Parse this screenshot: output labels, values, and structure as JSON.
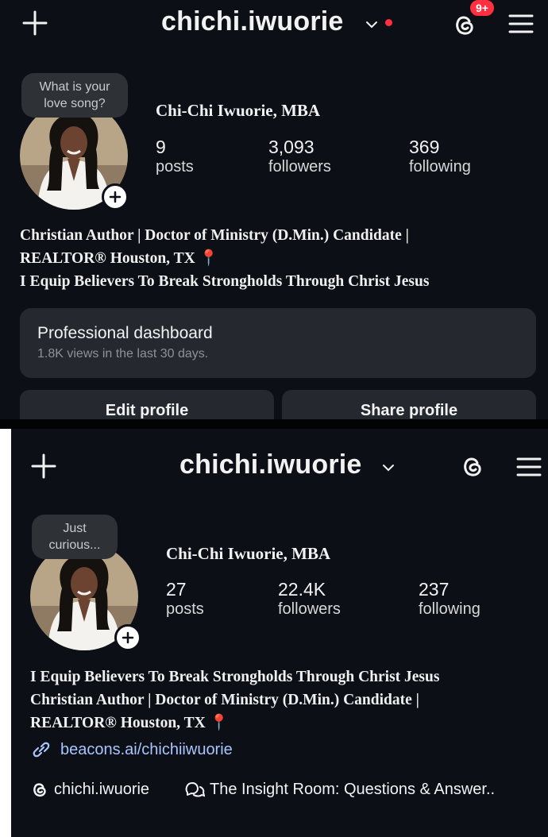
{
  "top": {
    "username": "chichi.iwuorie",
    "notification_badge": "9+",
    "note": "What is your love song?",
    "full_name": "Chi-Chi Iwuorie, MBA",
    "stats": [
      {
        "value": "9",
        "label": "posts"
      },
      {
        "value": "3,093",
        "label": "followers"
      },
      {
        "value": "369",
        "label": "following"
      }
    ],
    "bio": [
      "Christian Author | Doctor of Ministry (D.Min.) Candidate |",
      "REALTOR® Houston, TX",
      "I Equip Believers To Break Strongholds Through Christ Jesus"
    ],
    "dashboard": {
      "title": "Professional dashboard",
      "subtitle": "1.8K views in the last 30 days."
    },
    "buttons": {
      "edit": "Edit profile",
      "share": "Share profile"
    }
  },
  "bottom": {
    "username": "chichi.iwuorie",
    "note": "Just curious...",
    "full_name": "Chi-Chi Iwuorie, MBA",
    "stats": [
      {
        "value": "27",
        "label": "posts"
      },
      {
        "value": "22.4K",
        "label": "followers"
      },
      {
        "value": "237",
        "label": "following"
      }
    ],
    "bio": [
      "I Equip Believers To Break Strongholds Through Christ Jesus",
      "Christian Author | Doctor of Ministry (D.Min.) Candidate |",
      "REALTOR® Houston, TX"
    ],
    "link": "beacons.ai/chichiiwuorie",
    "threads_handle": "chichi.iwuorie",
    "channel": "The Insight Room: Questions & Answer.."
  },
  "icons": [
    "plus-icon",
    "chevron-down-icon",
    "threads-icon",
    "menu-icon",
    "link-icon",
    "chat-bubbles-icon",
    "location-pin-icon"
  ],
  "colors": {
    "background": "#0c0f15",
    "card": "#25292f",
    "accent_red": "#ff3040",
    "link": "#a8c5ff"
  }
}
